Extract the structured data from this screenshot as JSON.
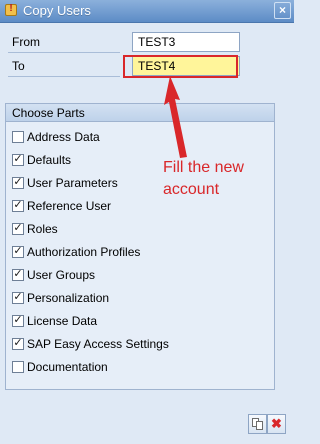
{
  "window": {
    "title": "Copy Users",
    "close_glyph": "×"
  },
  "fields": {
    "from_label": "From",
    "from_value": "TEST3",
    "to_label": "To",
    "to_value": "TEST4"
  },
  "parts": {
    "title": "Choose Parts",
    "items": [
      {
        "label": "Address Data",
        "checked": false
      },
      {
        "label": "Defaults",
        "checked": true
      },
      {
        "label": "User Parameters",
        "checked": true
      },
      {
        "label": "Reference User",
        "checked": true
      },
      {
        "label": "Roles",
        "checked": true
      },
      {
        "label": "Authorization Profiles",
        "checked": true
      },
      {
        "label": "User Groups",
        "checked": true
      },
      {
        "label": "Personalization",
        "checked": true
      },
      {
        "label": "License Data",
        "checked": true
      },
      {
        "label": "SAP Easy Access Settings",
        "checked": true
      },
      {
        "label": "Documentation",
        "checked": false
      }
    ]
  },
  "annotation": {
    "text_line1": "Fill the new",
    "text_line2": "account",
    "color": "#d9272a"
  },
  "footer": {
    "copy_icon": "copy-icon",
    "cancel_icon": "cancel-icon",
    "cancel_glyph": "✖"
  },
  "colors": {
    "titlebar": "#5d8cc6",
    "highlight_field": "#fff59a",
    "annotation_red": "#d9272a"
  }
}
